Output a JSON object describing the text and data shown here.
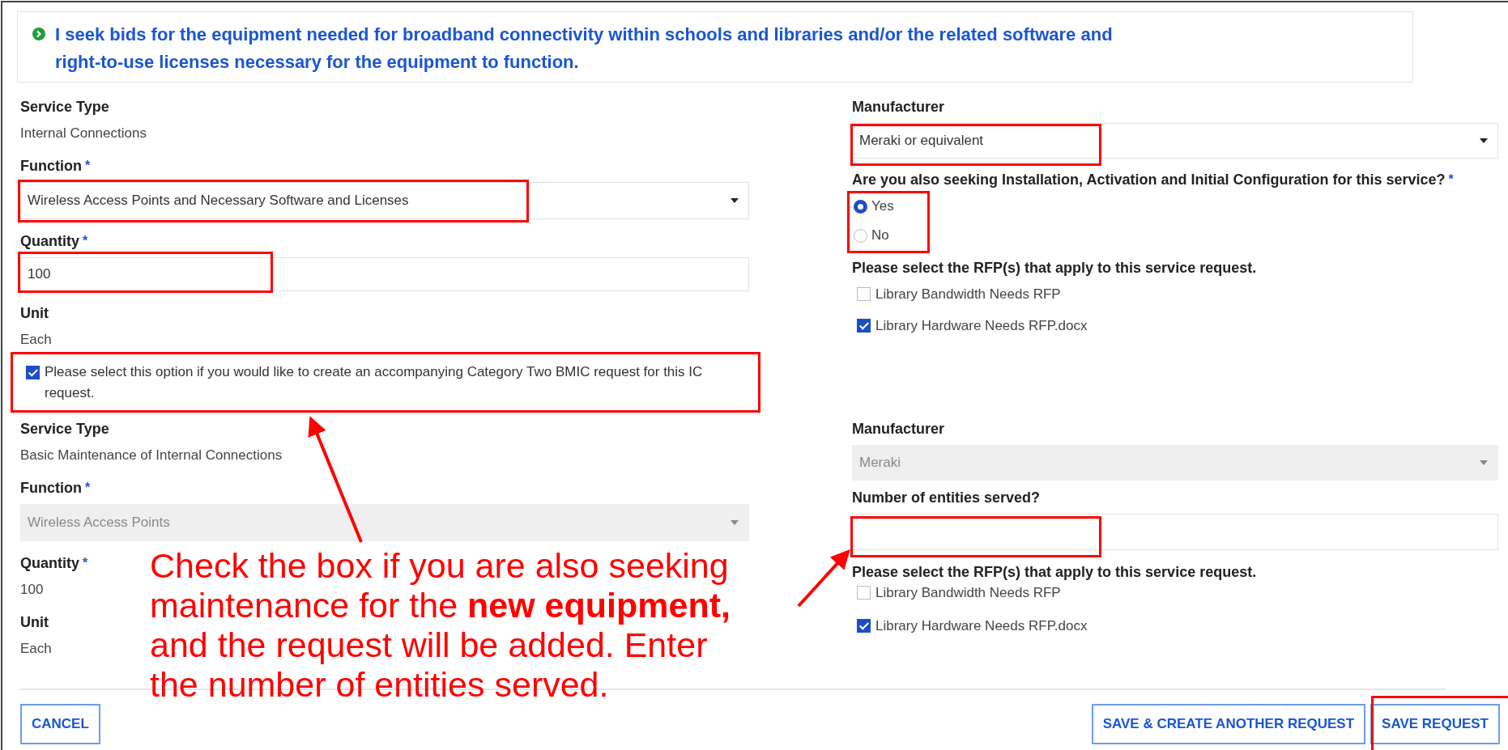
{
  "banner": {
    "lines": [
      "I seek bids for the equipment needed for broadband connectivity within schools and libraries and/or the related software and",
      "right-to-use licenses necessary for the equipment to function."
    ]
  },
  "sections": [
    {
      "left": [
        {
          "kind": "static",
          "label": "Service Type",
          "value": "Internal Connections"
        },
        {
          "kind": "select",
          "label": "Function",
          "required_mark": "*",
          "value": "Wireless Access Points and Necessary Software and Licenses",
          "disabled": false
        },
        {
          "kind": "input",
          "label": "Quantity",
          "required_mark": "*",
          "value": "100"
        },
        {
          "kind": "static",
          "label": "Unit",
          "value": "Each"
        },
        {
          "kind": "checkbox",
          "label": "Please select this option if you would like to create an accompanying Category Two BMIC request for this IC request.",
          "checked": true
        }
      ],
      "right": [
        {
          "kind": "select",
          "label": "Manufacturer",
          "value": "Meraki or equivalent",
          "disabled": false
        },
        {
          "kind": "radio",
          "label": "Are you also seeking Installation, Activation and Initial Configuration for this service?",
          "required_mark": "*",
          "options": [
            {
              "label": "Yes",
              "selected": true
            },
            {
              "label": "No",
              "selected": false
            }
          ]
        },
        {
          "kind": "checklist",
          "label": "Please select the RFP(s) that apply to this service request.",
          "options": [
            {
              "label": "Library Bandwidth Needs RFP",
              "checked": false
            },
            {
              "label": "Library Hardware Needs RFP.docx",
              "checked": true
            }
          ]
        }
      ]
    },
    {
      "left": [
        {
          "kind": "static",
          "label": "Service Type",
          "value": "Basic Maintenance of Internal Connections"
        },
        {
          "kind": "select",
          "label": "Function",
          "required_mark": "*",
          "value": "Wireless Access Points",
          "disabled": true
        },
        {
          "kind": "static",
          "label": "Quantity",
          "required_mark": "*",
          "value": "100"
        },
        {
          "kind": "static",
          "label": "Unit",
          "value": "Each"
        }
      ],
      "right": [
        {
          "kind": "select",
          "label": "Manufacturer",
          "value": "Meraki",
          "disabled": true
        },
        {
          "kind": "input",
          "label": "Number of entities served?"
        },
        {
          "kind": "checklist",
          "label": "Please select the RFP(s) that apply to this service request.",
          "options": [
            {
              "label": "Library Bandwidth Needs RFP",
              "checked": false
            },
            {
              "label": "Library Hardware Needs RFP.docx",
              "checked": true
            }
          ]
        }
      ]
    }
  ],
  "footer": {
    "left_buttons": [
      {
        "label": "CANCEL"
      }
    ],
    "right_buttons": [
      {
        "label": "SAVE & CREATE ANOTHER REQUEST"
      },
      {
        "label": "SAVE REQUEST"
      }
    ]
  },
  "callout": "Check the box if you are also seeking maintenance for the **new equipment,** and the request will be added. Enter the number of entities served."
}
